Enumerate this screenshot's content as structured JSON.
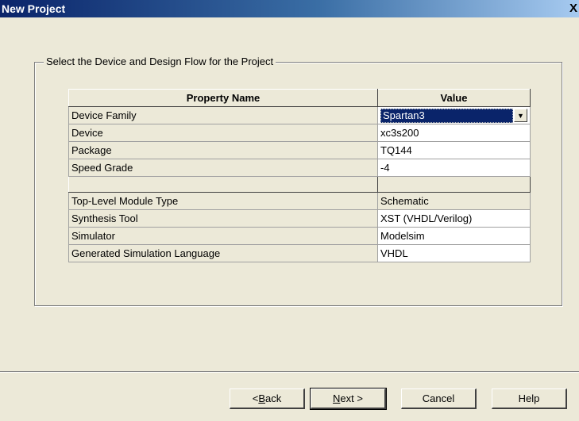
{
  "window": {
    "title": "New Project",
    "close_symbol": "X"
  },
  "group": {
    "legend": "Select the Device and Design Flow for the Project"
  },
  "table": {
    "headers": [
      "Property Name",
      "Value"
    ],
    "rows_top": [
      {
        "name": "Device Family",
        "value": "Spartan3"
      },
      {
        "name": "Device",
        "value": "xc3s200"
      },
      {
        "name": "Package",
        "value": "TQ144"
      },
      {
        "name": "Speed Grade",
        "value": "-4"
      }
    ],
    "rows_bottom": [
      {
        "name": "Top-Level Module Type",
        "value": "Schematic"
      },
      {
        "name": "Synthesis Tool",
        "value": "XST (VHDL/Verilog)"
      },
      {
        "name": "Simulator",
        "value": "Modelsim"
      },
      {
        "name": "Generated Simulation Language",
        "value": "VHDL"
      }
    ]
  },
  "buttons": {
    "back_prefix": "< ",
    "back_mnemonic": "B",
    "back_rest": "ack",
    "next_mnemonic": "N",
    "next_rest": "ext >",
    "cancel": "Cancel",
    "help": "Help"
  },
  "colors": {
    "title_start": "#0a246a",
    "title_end": "#a6caf0",
    "selection": "#0a246a",
    "dialog_bg": "#ece9d8"
  }
}
